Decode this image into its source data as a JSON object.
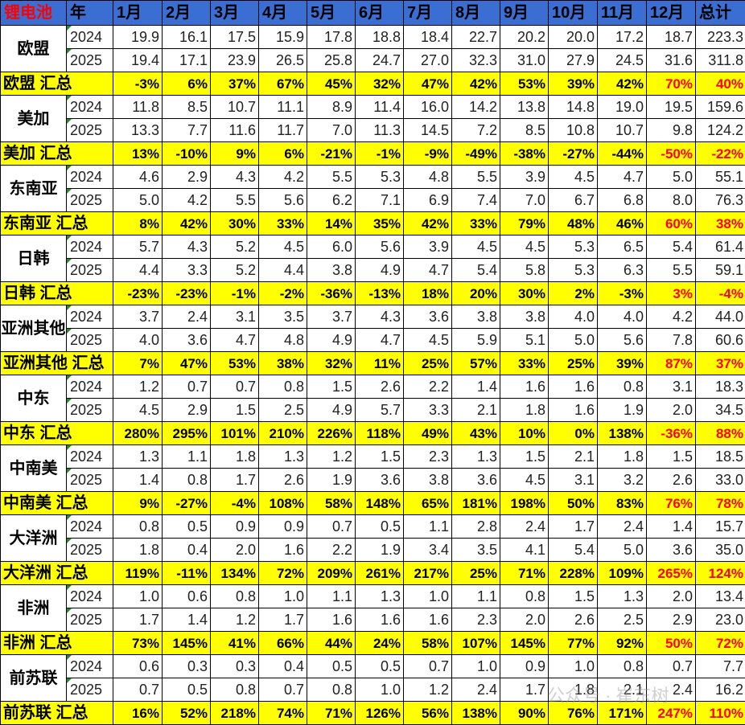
{
  "header": {
    "corner": "锂电池",
    "year": "年",
    "months": [
      "1月",
      "2月",
      "3月",
      "4月",
      "5月",
      "6月",
      "7月",
      "8月",
      "9月",
      "10月",
      "11月",
      "12月"
    ],
    "total": "总计"
  },
  "regions": [
    {
      "name": "欧盟",
      "sum_label": "欧盟 汇总",
      "y2024": {
        "year": "2024",
        "values": [
          "19.9",
          "16.1",
          "17.5",
          "15.9",
          "17.8",
          "18.8",
          "18.4",
          "22.7",
          "20.2",
          "20.0",
          "17.2",
          "18.7"
        ],
        "total": "223.3"
      },
      "y2025": {
        "year": "2025",
        "values": [
          "19.4",
          "17.1",
          "23.9",
          "26.5",
          "25.8",
          "24.7",
          "27.0",
          "32.3",
          "31.0",
          "27.9",
          "24.5",
          "31.6"
        ],
        "total": "311.8"
      },
      "growth": [
        "-3%",
        "6%",
        "37%",
        "67%",
        "45%",
        "32%",
        "47%",
        "42%",
        "53%",
        "39%",
        "42%",
        "70%"
      ],
      "growth_total": "40%"
    },
    {
      "name": "美加",
      "sum_label": "美加 汇总",
      "y2024": {
        "year": "2024",
        "values": [
          "11.8",
          "8.5",
          "10.7",
          "11.1",
          "8.9",
          "11.4",
          "16.0",
          "14.2",
          "13.8",
          "14.8",
          "19.0",
          "19.5"
        ],
        "total": "159.6"
      },
      "y2025": {
        "year": "2025",
        "values": [
          "13.3",
          "7.7",
          "11.6",
          "11.7",
          "7.0",
          "11.3",
          "14.5",
          "7.2",
          "8.5",
          "10.8",
          "10.7",
          "9.8"
        ],
        "total": "124.2"
      },
      "growth": [
        "13%",
        "-10%",
        "9%",
        "6%",
        "-21%",
        "-1%",
        "-9%",
        "-49%",
        "-38%",
        "-27%",
        "-44%",
        "-50%"
      ],
      "growth_total": "-22%"
    },
    {
      "name": "东南亚",
      "sum_label": "东南亚 汇总",
      "y2024": {
        "year": "2024",
        "values": [
          "4.6",
          "2.9",
          "4.3",
          "4.2",
          "5.5",
          "5.3",
          "4.8",
          "5.5",
          "3.9",
          "4.5",
          "4.7",
          "5.0"
        ],
        "total": "55.1"
      },
      "y2025": {
        "year": "2025",
        "values": [
          "5.0",
          "4.2",
          "5.5",
          "5.6",
          "6.2",
          "7.1",
          "6.9",
          "7.4",
          "7.0",
          "6.7",
          "6.8",
          "8.0"
        ],
        "total": "76.3"
      },
      "growth": [
        "8%",
        "42%",
        "30%",
        "33%",
        "14%",
        "35%",
        "42%",
        "33%",
        "79%",
        "48%",
        "46%",
        "60%"
      ],
      "growth_total": "38%"
    },
    {
      "name": "日韩",
      "sum_label": "日韩 汇总",
      "y2024": {
        "year": "2024",
        "values": [
          "5.7",
          "4.3",
          "5.2",
          "4.5",
          "6.0",
          "5.6",
          "3.9",
          "4.5",
          "4.5",
          "5.3",
          "6.5",
          "5.4"
        ],
        "total": "61.4"
      },
      "y2025": {
        "year": "2025",
        "values": [
          "4.4",
          "3.3",
          "5.2",
          "4.4",
          "3.8",
          "4.9",
          "4.7",
          "5.4",
          "5.8",
          "5.3",
          "6.3",
          "5.5"
        ],
        "total": "59.1"
      },
      "growth": [
        "-23%",
        "-23%",
        "-1%",
        "-2%",
        "-36%",
        "-13%",
        "18%",
        "20%",
        "30%",
        "2%",
        "-3%",
        "3%"
      ],
      "growth_total": "-4%"
    },
    {
      "name": "亚洲其他",
      "sum_label": "亚洲其他 汇总",
      "y2024": {
        "year": "2024",
        "values": [
          "3.7",
          "2.4",
          "3.1",
          "3.5",
          "3.7",
          "4.3",
          "3.6",
          "3.8",
          "3.8",
          "4.0",
          "4.0",
          "4.2"
        ],
        "total": "44.0"
      },
      "y2025": {
        "year": "2025",
        "values": [
          "4.0",
          "3.6",
          "4.7",
          "4.8",
          "4.9",
          "4.7",
          "4.5",
          "5.9",
          "5.1",
          "5.0",
          "5.6",
          "7.8"
        ],
        "total": "60.6"
      },
      "growth": [
        "7%",
        "47%",
        "53%",
        "38%",
        "32%",
        "11%",
        "25%",
        "57%",
        "33%",
        "25%",
        "39%",
        "87%"
      ],
      "growth_total": "37%"
    },
    {
      "name": "中东",
      "sum_label": "中东 汇总",
      "y2024": {
        "year": "2024",
        "values": [
          "1.2",
          "0.7",
          "0.7",
          "0.8",
          "1.5",
          "2.6",
          "2.2",
          "1.4",
          "1.6",
          "1.6",
          "0.8",
          "3.1"
        ],
        "total": "18.3"
      },
      "y2025": {
        "year": "2025",
        "values": [
          "4.5",
          "2.9",
          "1.5",
          "2.5",
          "4.9",
          "5.7",
          "3.3",
          "2.1",
          "1.8",
          "1.6",
          "1.9",
          "2.0"
        ],
        "total": "34.5"
      },
      "growth": [
        "280%",
        "295%",
        "101%",
        "210%",
        "226%",
        "118%",
        "49%",
        "43%",
        "10%",
        "0%",
        "138%",
        "-36%"
      ],
      "growth_total": "88%"
    },
    {
      "name": "中南美",
      "sum_label": "中南美 汇总",
      "y2024": {
        "year": "2024",
        "values": [
          "1.3",
          "1.1",
          "1.8",
          "1.3",
          "1.2",
          "1.5",
          "2.3",
          "1.3",
          "1.5",
          "2.1",
          "1.8",
          "1.5"
        ],
        "total": "18.5"
      },
      "y2025": {
        "year": "2025",
        "values": [
          "1.4",
          "0.8",
          "1.7",
          "2.6",
          "1.9",
          "3.6",
          "3.8",
          "3.6",
          "4.5",
          "3.1",
          "3.2",
          "2.6"
        ],
        "total": "33.0"
      },
      "growth": [
        "9%",
        "-27%",
        "-4%",
        "108%",
        "58%",
        "148%",
        "65%",
        "181%",
        "198%",
        "50%",
        "83%",
        "76%"
      ],
      "growth_total": "78%"
    },
    {
      "name": "大洋洲",
      "sum_label": "大洋洲 汇总",
      "y2024": {
        "year": "2024",
        "values": [
          "0.8",
          "0.5",
          "0.9",
          "0.9",
          "0.7",
          "0.5",
          "1.1",
          "2.8",
          "2.4",
          "1.7",
          "2.4",
          "1.4"
        ],
        "total": "15.7"
      },
      "y2025": {
        "year": "2025",
        "values": [
          "1.8",
          "0.4",
          "2.0",
          "1.6",
          "2.2",
          "1.9",
          "3.4",
          "3.5",
          "4.1",
          "5.4",
          "5.0",
          "3.6"
        ],
        "total": "35.0"
      },
      "growth": [
        "119%",
        "-11%",
        "134%",
        "72%",
        "209%",
        "261%",
        "217%",
        "25%",
        "71%",
        "228%",
        "109%",
        "265%"
      ],
      "growth_total": "124%"
    },
    {
      "name": "非洲",
      "sum_label": "非洲 汇总",
      "y2024": {
        "year": "2024",
        "values": [
          "1.0",
          "0.6",
          "0.8",
          "1.0",
          "1.1",
          "1.3",
          "1.0",
          "1.1",
          "0.8",
          "1.5",
          "1.3",
          "2.0"
        ],
        "total": "13.4"
      },
      "y2025": {
        "year": "2025",
        "values": [
          "1.7",
          "1.4",
          "1.2",
          "1.7",
          "1.6",
          "1.6",
          "1.6",
          "2.3",
          "2.0",
          "2.6",
          "2.5",
          "2.9"
        ],
        "total": "23.0"
      },
      "growth": [
        "73%",
        "145%",
        "41%",
        "66%",
        "44%",
        "24%",
        "58%",
        "107%",
        "145%",
        "77%",
        "92%",
        "50%"
      ],
      "growth_total": "72%"
    },
    {
      "name": "前苏联",
      "sum_label": "前苏联 汇总",
      "y2024": {
        "year": "2024",
        "values": [
          "0.6",
          "0.3",
          "0.3",
          "0.4",
          "0.5",
          "0.5",
          "0.7",
          "1.0",
          "0.9",
          "1.0",
          "0.8",
          "0.7"
        ],
        "total": "7.7"
      },
      "y2025": {
        "year": "2025",
        "values": [
          "0.7",
          "0.5",
          "0.8",
          "0.7",
          "0.8",
          "1.0",
          "1.2",
          "2.4",
          "1.7",
          "1.8",
          "2.1",
          "2.4"
        ],
        "total": "16.2"
      },
      "growth": [
        "16%",
        "52%",
        "218%",
        "74%",
        "71%",
        "126%",
        "56%",
        "138%",
        "90%",
        "76%",
        "171%",
        "247%"
      ],
      "growth_total": "110%"
    }
  ],
  "colors": {
    "header_bg": "#3a6ed3",
    "summary_bg": "#ffff00",
    "highlight_text": "#ff0000"
  },
  "watermark": "公众号 · 崔东树"
}
